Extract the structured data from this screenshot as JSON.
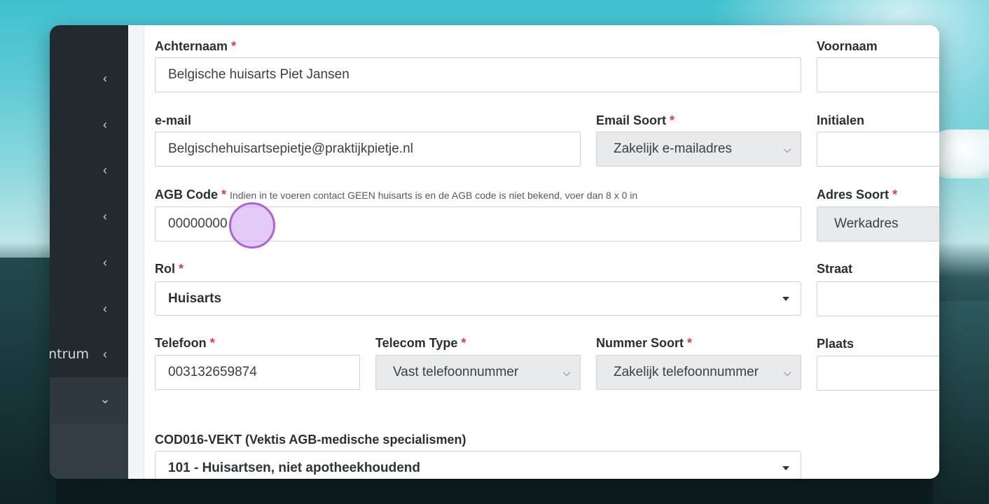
{
  "sidebar": {
    "items": [
      {
        "label": ""
      },
      {
        "label": ""
      },
      {
        "label": ""
      },
      {
        "label": ""
      },
      {
        "label": ""
      },
      {
        "label": ""
      },
      {
        "label": "ntrum"
      },
      {
        "label": ""
      }
    ],
    "chev_left": "‹",
    "chev_down": "⌄"
  },
  "form": {
    "achternaam": {
      "label": "Achternaam",
      "value": "Belgische huisarts Piet Jansen"
    },
    "voornaam": {
      "label": "Voornaam",
      "value": ""
    },
    "email": {
      "label": "e-mail",
      "value": "Belgischehuisartsepietje@praktijkpietje.nl"
    },
    "email_soort": {
      "label": "Email Soort",
      "value": "Zakelijk e-mailadres"
    },
    "initialen": {
      "label": "Initialen",
      "value": ""
    },
    "agb": {
      "label": "AGB Code",
      "hint": "Indien in te voeren contact GEEN huisarts is en de AGB code is niet bekend, voer dan 8 x 0 in",
      "value": "00000000"
    },
    "adres_soort": {
      "label": "Adres Soort",
      "value": "Werkadres"
    },
    "rol": {
      "label": "Rol",
      "value": "Huisarts"
    },
    "straat": {
      "label": "Straat",
      "value": ""
    },
    "telefoon": {
      "label": "Telefoon",
      "value": "003132659874"
    },
    "telecom_type": {
      "label": "Telecom Type",
      "value": "Vast telefoonnummer"
    },
    "nummer_soort": {
      "label": "Nummer Soort",
      "value": "Zakelijk telefoonnummer"
    },
    "plaats": {
      "label": "Plaats",
      "value": ""
    },
    "cod016": {
      "label": "COD016-VEKT (Vektis AGB-medische specialismen)",
      "value": "101 - Huisartsen, niet apotheekhoudend"
    },
    "required_mark": "*"
  },
  "colors": {
    "accent_required": "#e0393e",
    "sidebar_bg": "#22292f",
    "cursor_ring": "#a964d6"
  }
}
